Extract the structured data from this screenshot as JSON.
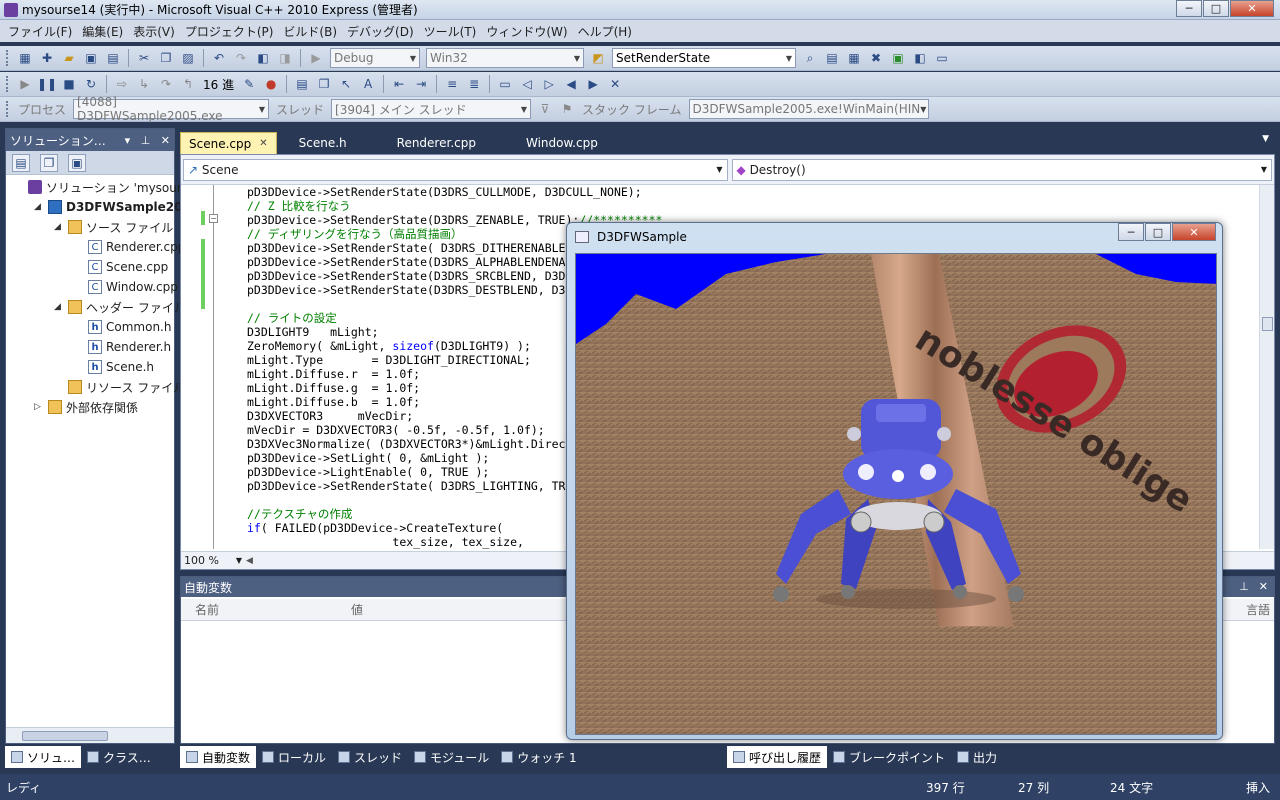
{
  "window": {
    "title": "mysourse14 (実行中) - Microsoft Visual C++ 2010 Express (管理者)",
    "buttons": {
      "minimize": "─",
      "maximize": "□",
      "close": "✕"
    }
  },
  "menu": [
    "ファイル(F)",
    "編集(E)",
    "表示(V)",
    "プロジェクト(P)",
    "ビルド(B)",
    "デバッグ(D)",
    "ツール(T)",
    "ウィンドウ(W)",
    "ヘルプ(H)"
  ],
  "toolbar1": {
    "config": "Debug",
    "platform": "Win32",
    "find": "SetRenderState"
  },
  "toolbar2": {
    "hex_display": "16 進"
  },
  "toolbar3": {
    "process_label": "プロセス",
    "process": "[4088] D3DFWSample2005.exe",
    "thread_label": "スレッド",
    "thread": "[3904] メイン スレッド",
    "stackframe_label": "スタック フレーム",
    "stackframe": "D3DFWSample2005.exe!WinMain(HIN"
  },
  "solution_explorer": {
    "title": "ソリューション…",
    "items": [
      {
        "label": "ソリューション 'mysour",
        "icon": "solution-icon",
        "indent": 0,
        "twisty": ""
      },
      {
        "label": "D3DFWSample200",
        "icon": "project-icon",
        "indent": 1,
        "twisty": "◢",
        "bold": true
      },
      {
        "label": "ソース ファイル",
        "icon": "folder-icon",
        "indent": 2,
        "twisty": "◢"
      },
      {
        "label": "Renderer.cpp",
        "icon": "cpp-file-icon",
        "indent": 3,
        "twisty": ""
      },
      {
        "label": "Scene.cpp",
        "icon": "cpp-file-icon",
        "indent": 3,
        "twisty": ""
      },
      {
        "label": "Window.cpp",
        "icon": "cpp-file-icon",
        "indent": 3,
        "twisty": ""
      },
      {
        "label": "ヘッダー ファイル",
        "icon": "folder-icon",
        "indent": 2,
        "twisty": "◢"
      },
      {
        "label": "Common.h",
        "icon": "header-file-icon",
        "indent": 3,
        "twisty": ""
      },
      {
        "label": "Renderer.h",
        "icon": "header-file-icon",
        "indent": 3,
        "twisty": ""
      },
      {
        "label": "Scene.h",
        "icon": "header-file-icon",
        "indent": 3,
        "twisty": ""
      },
      {
        "label": "リソース ファイル",
        "icon": "folder-icon",
        "indent": 2,
        "twisty": ""
      },
      {
        "label": "外部依存関係",
        "icon": "folder-icon",
        "indent": 1,
        "twisty": "▷"
      }
    ],
    "bottom_tabs": [
      "ソリュ…",
      "クラス…"
    ]
  },
  "editor": {
    "tabs": [
      {
        "label": "Scene.cpp",
        "active": true
      },
      {
        "label": "Scene.h",
        "active": false
      },
      {
        "label": "Renderer.cpp",
        "active": false
      },
      {
        "label": "Window.cpp",
        "active": false
      }
    ],
    "nav_left": "Scene",
    "nav_right": "Destroy()",
    "zoom": "100 %",
    "lines": [
      "pD3DDevice->SetRenderState(D3DRS_CULLMODE, D3DCULL_NONE);",
      "// Z 比較を行なう",
      "pD3DDevice->SetRenderState(D3DRS_ZENABLE, TRUE);//**********",
      "// ディザリングを行なう（高品質描画）",
      "pD3DDevice->SetRenderState( D3DRS_DITHERENABLE",
      "pD3DDevice->SetRenderState(D3DRS_ALPHABLENDENA",
      "pD3DDevice->SetRenderState(D3DRS_SRCBLEND, D3D",
      "pD3DDevice->SetRenderState(D3DRS_DESTBLEND, D3",
      "",
      "// ライトの設定",
      "D3DLIGHT9   mLight;",
      "ZeroMemory( &mLight, sizeof(D3DLIGHT9) );",
      "mLight.Type       = D3DLIGHT_DIRECTIONAL;",
      "mLight.Diffuse.r  = 1.0f;",
      "mLight.Diffuse.g  = 1.0f;",
      "mLight.Diffuse.b  = 1.0f;",
      "D3DXVECTOR3     mVecDir;",
      "mVecDir = D3DXVECTOR3( -0.5f, -0.5f, 1.0f);",
      "D3DXVec3Normalize( (D3DXVECTOR3*)&mLight.Direc",
      "pD3DDevice->SetLight( 0, &mLight );",
      "pD3DDevice->LightEnable( 0, TRUE );",
      "pD3DDevice->SetRenderState( D3DRS_LIGHTING, TR",
      "",
      "//テクスチャの作成",
      "if( FAILED(pD3DDevice->CreateTexture(",
      "                     tex_size, tex_size,"
    ]
  },
  "autos": {
    "title": "自動変数",
    "col_name": "名前",
    "col_value": "値",
    "col_lang": "言語",
    "bottom_tabs": [
      "自動変数",
      "ローカル",
      "スレッド",
      "モジュール",
      "ウォッチ 1"
    ]
  },
  "callstack_tabs": [
    "呼び出し履歴",
    "ブレークポイント",
    "出力"
  ],
  "statusbar": {
    "ready": "レディ",
    "line": "397 行",
    "col": "27 列",
    "ch": "24 文字",
    "mode": "挿入"
  },
  "d3d_window": {
    "title": "D3DFWSample",
    "logo_text": "noblesse oblige"
  },
  "colors": {
    "accent": "#4d6082",
    "background": "#293955",
    "sky": "#0000ff",
    "terrain": "#9d7a5c",
    "robot": "#4b4fd4",
    "logo": "#b3202f"
  }
}
